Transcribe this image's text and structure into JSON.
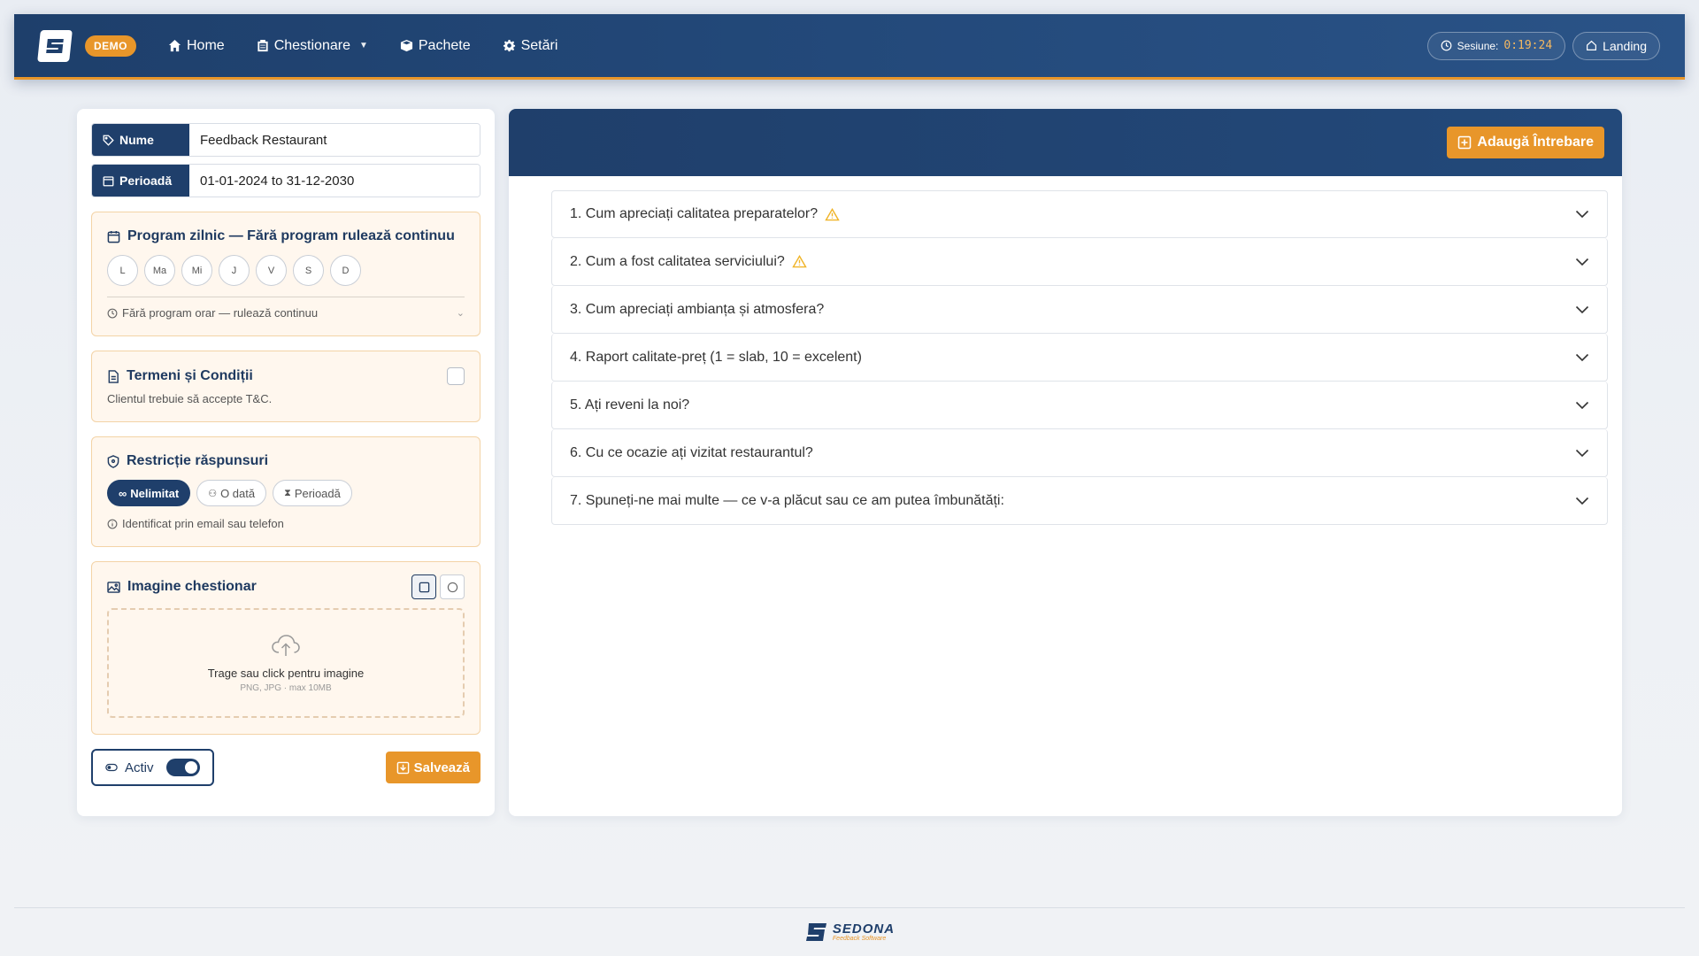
{
  "nav": {
    "badge": "DEMO",
    "items": [
      {
        "label": "Home",
        "icon": "home-icon"
      },
      {
        "label": "Chestionare",
        "icon": "clipboard-icon"
      },
      {
        "label": "Pachete",
        "icon": "box-icon"
      },
      {
        "label": "Setări",
        "icon": "gear-icon"
      }
    ],
    "session_label": "Sesiune:",
    "session_timer": "0:19:24",
    "landing_label": "Landing"
  },
  "form": {
    "name_label": "Nume",
    "name_value": "Feedback Restaurant",
    "period_label": "Perioadă",
    "period_value": "01-01-2024 to 31-12-2030"
  },
  "schedule": {
    "title": "Program zilnic — Fără program rulează continuu",
    "days": [
      "L",
      "Ma",
      "Mi",
      "J",
      "V",
      "S",
      "D"
    ],
    "note": "Fără program orar — rulează continuu"
  },
  "terms": {
    "title": "Termeni și Condiții",
    "subtitle": "Clientul trebuie să accepte T&C."
  },
  "restriction": {
    "title": "Restricție răspunsuri",
    "options": [
      "Nelimitat",
      "O dată",
      "Perioadă"
    ],
    "selected": "Nelimitat",
    "note": "Identificat prin email sau telefon"
  },
  "image": {
    "title": "Imagine chestionar",
    "drop_text": "Trage sau click pentru imagine",
    "drop_hint": "PNG, JPG · max 10MB"
  },
  "bottom": {
    "active_label": "Activ",
    "save_label": "Salvează"
  },
  "questions_panel": {
    "add_label": "Adaugă Întrebare",
    "questions": [
      {
        "text": "1. Cum apreciați calitatea preparatelor?",
        "warn": true
      },
      {
        "text": "2. Cum a fost calitatea serviciului?",
        "warn": true
      },
      {
        "text": "3. Cum apreciați ambianța și atmosfera?",
        "warn": false
      },
      {
        "text": "4. Raport calitate-preț (1 = slab, 10 = excelent)",
        "warn": false
      },
      {
        "text": "5. Ați reveni la noi?",
        "warn": false
      },
      {
        "text": "6. Cu ce ocazie ați vizitat restaurantul?",
        "warn": false
      },
      {
        "text": "7. Spuneți-ne mai multe — ce v-a plăcut sau ce am putea îmbunătăți:",
        "warn": false
      }
    ]
  },
  "footer": {
    "brand": "SEDONA",
    "tagline": "Feedback Software"
  },
  "colors": {
    "primary": "#1f3f6b",
    "accent": "#e8962a",
    "warning": "#f0b429"
  }
}
